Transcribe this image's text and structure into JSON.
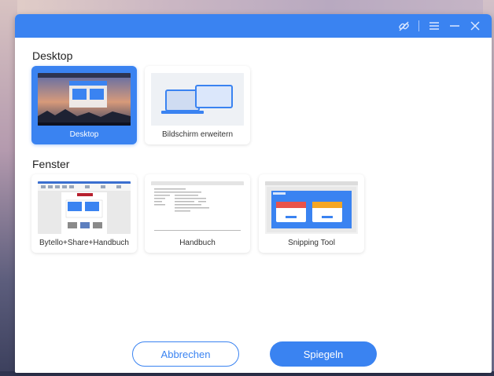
{
  "sections": {
    "desktop": {
      "title": "Desktop",
      "items": [
        {
          "label": "Desktop",
          "selected": true
        },
        {
          "label": "Bildschirm erweitern",
          "selected": false
        }
      ]
    },
    "windows": {
      "title": "Fenster",
      "items": [
        {
          "label": "Bytello+Share+Handbuch"
        },
        {
          "label": "Handbuch"
        },
        {
          "label": "Snipping Tool"
        }
      ]
    }
  },
  "buttons": {
    "cancel": "Abbrechen",
    "mirror": "Spiegeln"
  },
  "titlebar_icons": [
    "link-icon",
    "menu-icon",
    "minimize-icon",
    "close-icon"
  ],
  "colors": {
    "accent": "#3a83f1"
  }
}
